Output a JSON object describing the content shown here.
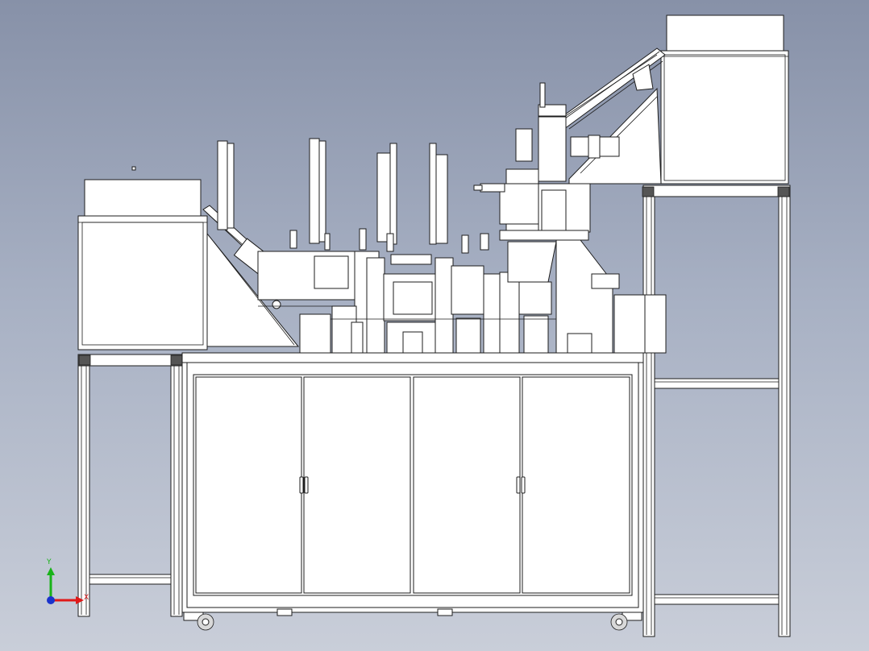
{
  "triad": {
    "y_label": "Y",
    "x_label": "X",
    "y_color": "#19b319",
    "x_color": "#e01919",
    "origin_color": "#1a33cc"
  },
  "colors": {
    "background_top": "#8791a8",
    "background_bottom": "#c9ced9",
    "outline": "#1d1d1d",
    "surface": "#ffffff"
  }
}
